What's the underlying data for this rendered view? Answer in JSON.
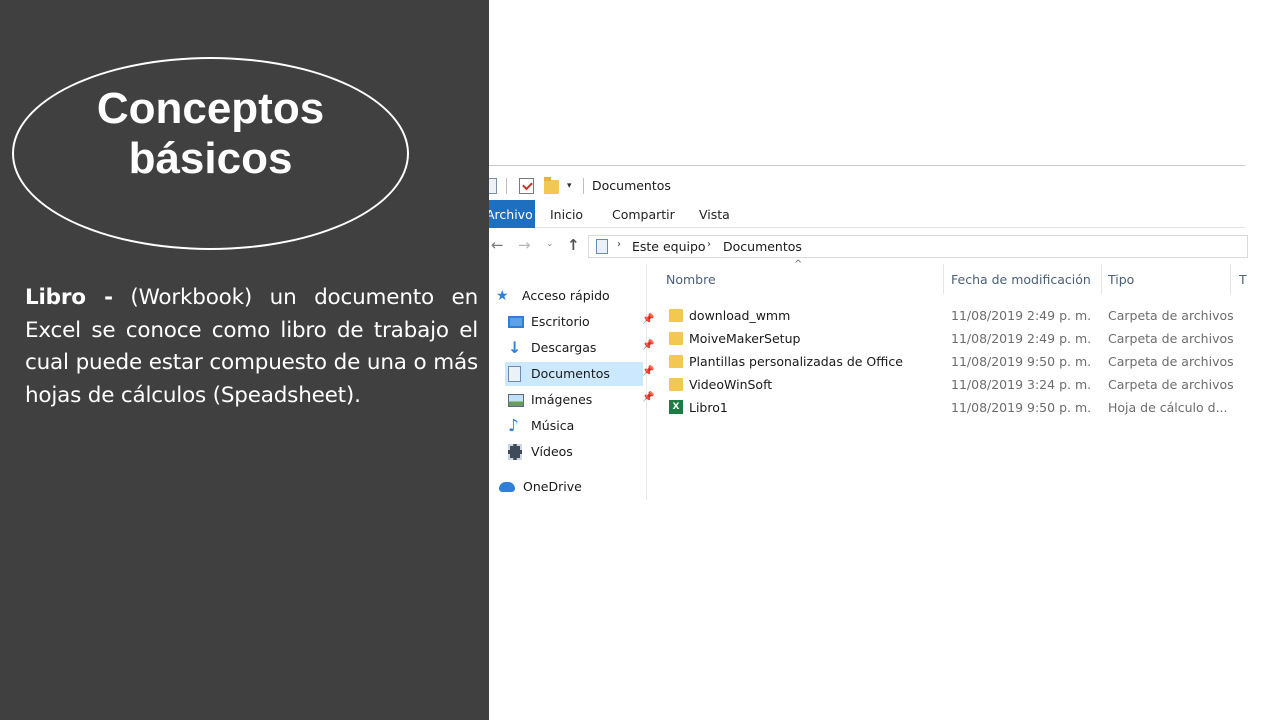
{
  "slide": {
    "title_line1": "Conceptos",
    "title_line2": "básicos",
    "term": "Libro -",
    "body": "(Workbook) un documento en Excel se conoce como libro de trabajo el cual puede estar compuesto de una o más hojas de cálculos (Speadsheet).",
    "background_color": "#404040"
  },
  "explorer": {
    "window_title": "Documentos",
    "quick_access_dropdown": "▾",
    "ribbon_tabs": [
      "Archivo",
      "Inicio",
      "Compartir",
      "Vista"
    ],
    "nav_buttons": {
      "back": "←",
      "forward": "→",
      "recent": "⌄",
      "up": "↑"
    },
    "address": {
      "separator": "›",
      "crumbs": [
        "Este equipo",
        "Documentos"
      ]
    },
    "navigation": {
      "quick_access": "Acceso rápido",
      "items": [
        {
          "label": "Escritorio",
          "icon": "desktop-icon",
          "pinned": true
        },
        {
          "label": "Descargas",
          "icon": "download-icon",
          "pinned": true
        },
        {
          "label": "Documentos",
          "icon": "documents-icon",
          "pinned": true,
          "selected": true
        },
        {
          "label": "Imágenes",
          "icon": "pictures-icon",
          "pinned": true
        },
        {
          "label": "Música",
          "icon": "music-icon",
          "pinned": false
        },
        {
          "label": "Vídeos",
          "icon": "videos-icon",
          "pinned": false
        }
      ],
      "onedrive": "OneDrive",
      "pin_glyph": "📌"
    },
    "columns": [
      "Nombre",
      "Fecha de modificación",
      "Tipo",
      "T"
    ],
    "files": [
      {
        "name": "download_wmm",
        "date": "11/08/2019 2:49 p. m.",
        "type": "Carpeta de archivos",
        "icon": "folder-icon"
      },
      {
        "name": "MoiveMakerSetup",
        "date": "11/08/2019 2:49 p. m.",
        "type": "Carpeta de archivos",
        "icon": "folder-icon"
      },
      {
        "name": "Plantillas personalizadas de Office",
        "date": "11/08/2019 9:50 p. m.",
        "type": "Carpeta de archivos",
        "icon": "folder-icon"
      },
      {
        "name": "VideoWinSoft",
        "date": "11/08/2019 3:24 p. m.",
        "type": "Carpeta de archivos",
        "icon": "folder-icon"
      },
      {
        "name": "Libro1",
        "date": "11/08/2019 9:50 p. m.",
        "type": "Hoja de cálculo d...",
        "icon": "excel-file-icon"
      }
    ],
    "accent_color": "#1f6fc0",
    "selected_color": "#cce8ff"
  }
}
